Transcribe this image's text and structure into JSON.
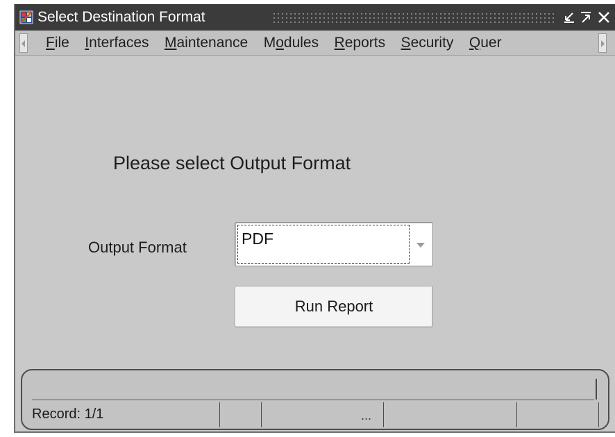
{
  "window": {
    "title": "Select Destination Format",
    "controls": {
      "minimize_icon": "minimize-icon",
      "maximize_icon": "maximize-icon",
      "close_icon": "close-icon"
    }
  },
  "menu": {
    "items": [
      {
        "pre": "",
        "u": "F",
        "post": "ile"
      },
      {
        "pre": "",
        "u": "I",
        "post": "nterfaces"
      },
      {
        "pre": "",
        "u": "M",
        "post": "aintenance"
      },
      {
        "pre": "M",
        "u": "o",
        "post": "dules"
      },
      {
        "pre": "",
        "u": "R",
        "post": "eports"
      },
      {
        "pre": "",
        "u": "S",
        "post": "ecurity"
      },
      {
        "pre": "",
        "u": "Q",
        "post": "uer"
      }
    ]
  },
  "content": {
    "heading": "Please select Output Format",
    "output_format": {
      "label": "Output Format",
      "value": "PDF"
    },
    "run_button": "Run Report"
  },
  "status": {
    "record": "Record: 1/1",
    "ellipsis": "..."
  },
  "colors": {
    "titlebar": "#3b3b3b",
    "background": "#c9c9c9"
  }
}
